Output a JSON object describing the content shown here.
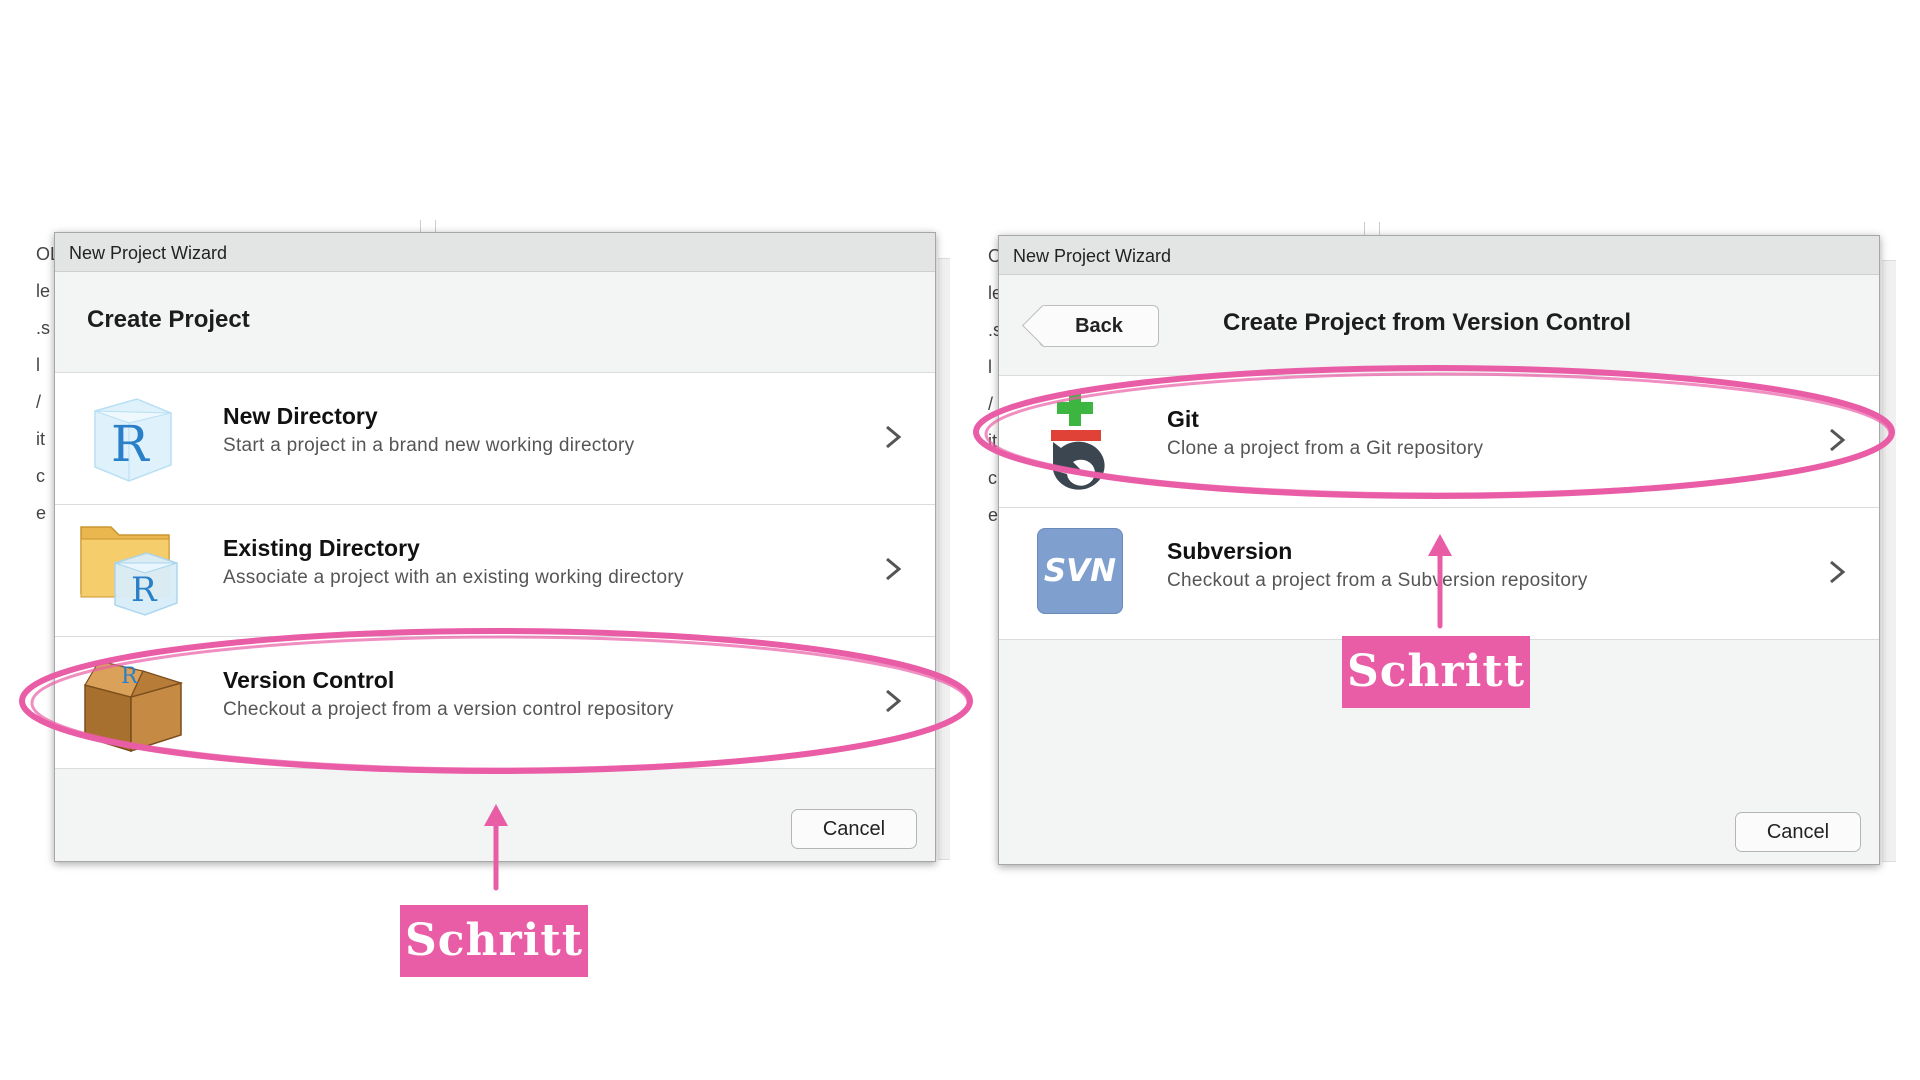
{
  "background_fragments": [
    "OL",
    "le",
    ".s",
    "l",
    "/",
    "it",
    "c",
    "e"
  ],
  "left_dialog": {
    "window_title": "New Project Wizard",
    "header_title": "Create Project",
    "options": [
      {
        "title": "New Directory",
        "description": "Start a project in a brand new working directory",
        "icon": "r-cube-icon"
      },
      {
        "title": "Existing Directory",
        "description": "Associate a project with an existing working directory",
        "icon": "folder-r-icon"
      },
      {
        "title": "Version Control",
        "description": "Checkout a project from a version control repository",
        "icon": "box-icon"
      }
    ],
    "cancel_label": "Cancel"
  },
  "right_dialog": {
    "window_title": "New Project Wizard",
    "back_label": "Back",
    "header_title": "Create Project from Version Control",
    "options": [
      {
        "title": "Git",
        "description": "Clone a project from a Git repository",
        "icon": "git-icon"
      },
      {
        "title": "Subversion",
        "description": "Checkout a project from a Subversion repository",
        "icon": "svn-icon",
        "icon_text": "SVN"
      }
    ],
    "cancel_label": "Cancel"
  },
  "annotations": {
    "label_left": "Schritt",
    "label_right": "Schritt",
    "color": "#e95da6"
  }
}
